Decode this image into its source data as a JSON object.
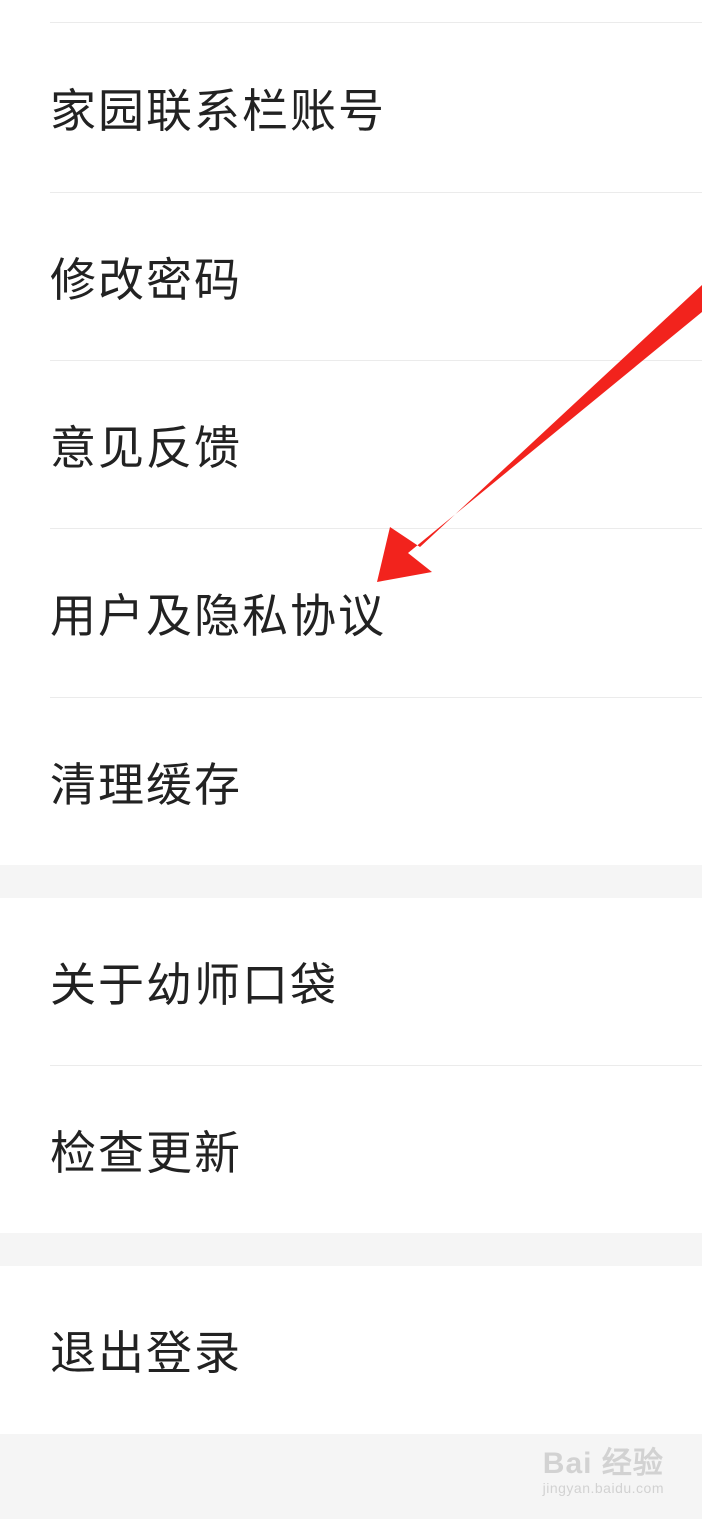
{
  "settings": {
    "group1": [
      {
        "label": "家园联系栏账号"
      },
      {
        "label": "修改密码"
      },
      {
        "label": "意见反馈"
      },
      {
        "label": "用户及隐私协议"
      },
      {
        "label": "清理缓存"
      }
    ],
    "group2": [
      {
        "label": "关于幼师口袋"
      },
      {
        "label": "检查更新"
      }
    ],
    "group3": [
      {
        "label": "退出登录"
      }
    ]
  },
  "annotation": {
    "arrow_color": "#f2231d"
  },
  "watermark": {
    "brand": "Bai 经验",
    "url": "jingyan.baidu.com"
  }
}
